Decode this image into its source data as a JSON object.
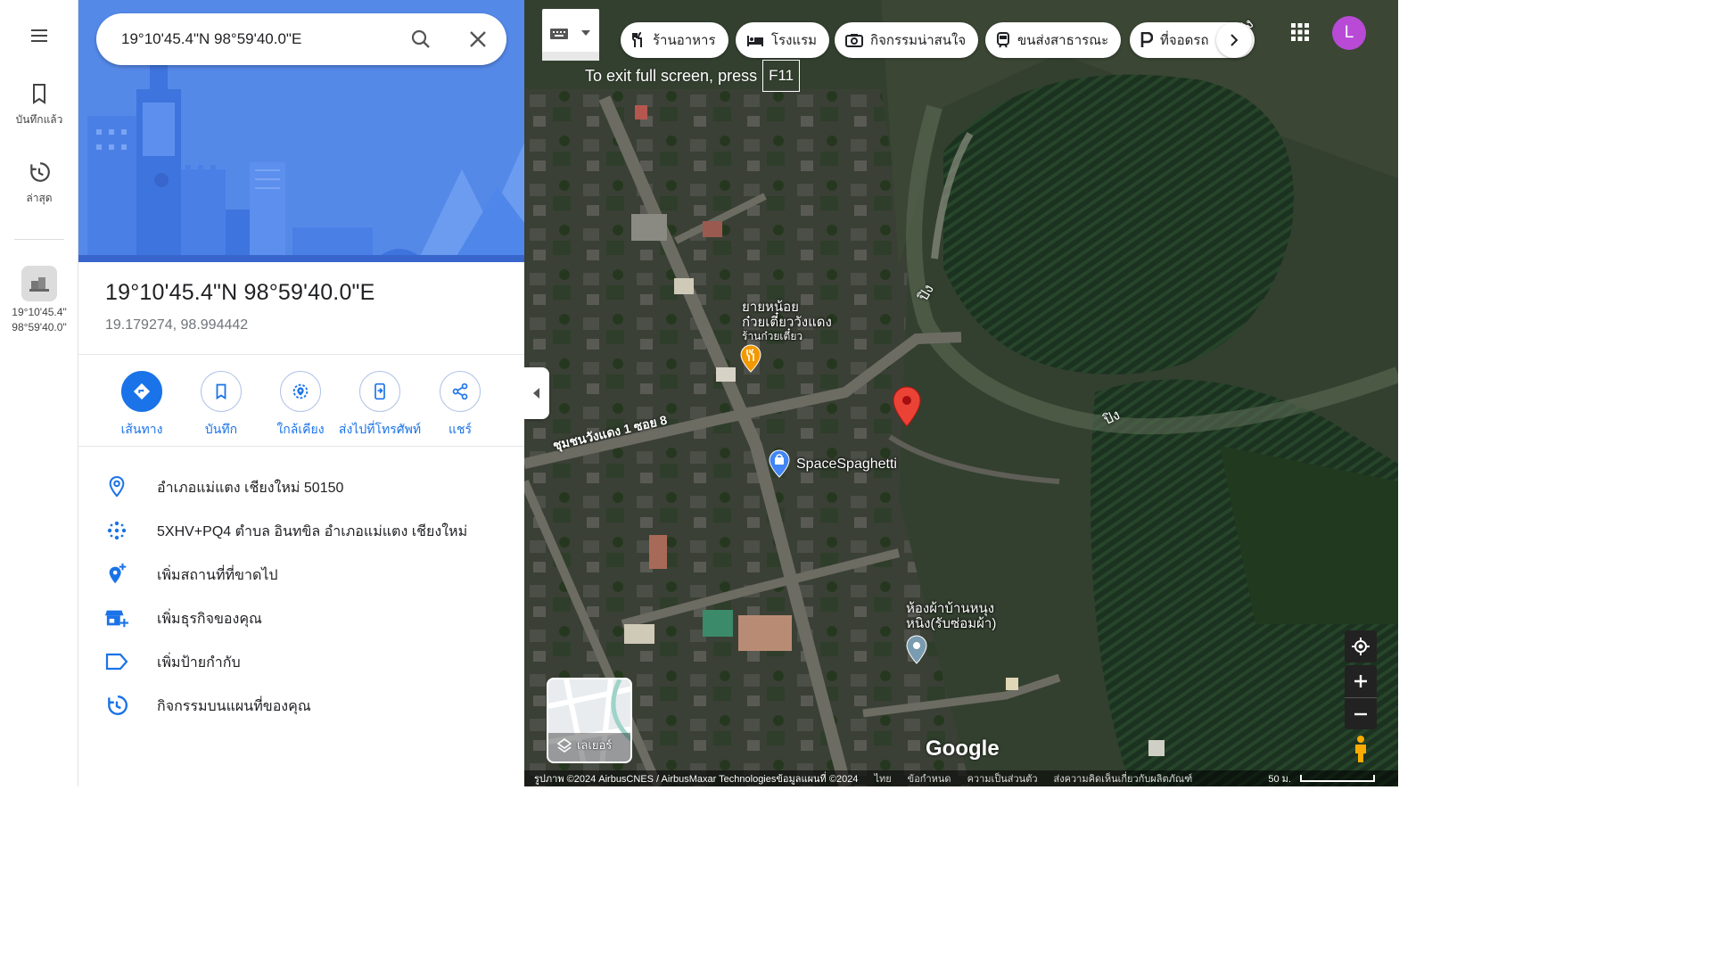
{
  "rail": {
    "menu_icon": "hamburger-icon",
    "saved_label": "บันทึกแล้ว",
    "recent_label": "ล่าสุด",
    "recent_place_line1": "19°10'45.4\"",
    "recent_place_line2": "98°59'40.0\""
  },
  "search": {
    "value": "19°10'45.4\"N 98°59'40.0\"E"
  },
  "place": {
    "title": "19°10'45.4\"N 98°59'40.0\"E",
    "decimal": "19.179274, 98.994442"
  },
  "actions": [
    {
      "label": "เส้นทาง",
      "icon": "directions-icon"
    },
    {
      "label": "บันทึก",
      "icon": "bookmark-icon"
    },
    {
      "label": "ใกล้เคียง",
      "icon": "nearby-icon"
    },
    {
      "label": "ส่งไปที่โทรศัพท์",
      "icon": "send-to-phone-icon"
    },
    {
      "label": "แชร์",
      "icon": "share-icon"
    }
  ],
  "details": [
    {
      "text": "อำเภอแม่แตง เชียงใหม่ 50150",
      "icon": "location-pin-icon"
    },
    {
      "text": "5XHV+PQ4 ตำบล อินทขิล อำเภอแม่แตง เชียงใหม่",
      "icon": "plus-code-icon"
    },
    {
      "text": "เพิ่มสถานที่ที่ขาดไป",
      "icon": "add-place-icon"
    },
    {
      "text": "เพิ่มธุรกิจของคุณ",
      "icon": "add-business-icon"
    },
    {
      "text": "เพิ่มป้ายกำกับ",
      "icon": "label-icon"
    },
    {
      "text": "กิจกรรมบนแผนที่ของคุณ",
      "icon": "history-icon"
    }
  ],
  "map": {
    "exit_hint": "To exit full screen, press",
    "exit_key": "F11",
    "chips": [
      {
        "label": "ร้านอาหาร",
        "icon": "restaurant-icon"
      },
      {
        "label": "โรงแรม",
        "icon": "hotel-icon"
      },
      {
        "label": "กิจกรรมน่าสนใจ",
        "icon": "camera-icon"
      },
      {
        "label": "ขนส่งสาธารณะ",
        "icon": "transit-icon"
      },
      {
        "label": "ที่จอดรถ",
        "icon": "parking-icon"
      }
    ],
    "avatar_letter": "L",
    "poi": {
      "noodle_line1": "ยายหน้อย",
      "noodle_line2": "ก๋วยเตี๋ยววังแดง",
      "noodle_sub": "ร้านก๋วยเตี๋ยว",
      "spaghetti": "SpaceSpaghetti",
      "tailor_line1": "ห้องผ้าบ้านหนุง",
      "tailor_line2": "หนิง(รับซ่อมผ้า)"
    },
    "road_label": "ชุมชนวังแดง 1 ซอย 8",
    "river_label_1": "ปิง",
    "river_label_2": "ปิง",
    "river_label_3": "ปิง",
    "layers_label": "เลเยอร์",
    "google_logo": "Google",
    "footer": {
      "imagery": "รูปภาพ ©2024 AirbusCNES / AirbusMaxar Technologiesข้อมูลแผนที่ ©2024",
      "lang": "ไทย",
      "terms": "ข้อกำหนด",
      "privacy": "ความเป็นส่วนตัว",
      "feedback": "ส่งความคิดเห็นเกี่ยวกับผลิตภัณฑ์",
      "scale": "50 ม."
    }
  },
  "colors": {
    "accent": "#1a73e8",
    "pin_red": "#ea4335",
    "avatar": "#b84ad6",
    "hero": "#4a7fe6"
  }
}
